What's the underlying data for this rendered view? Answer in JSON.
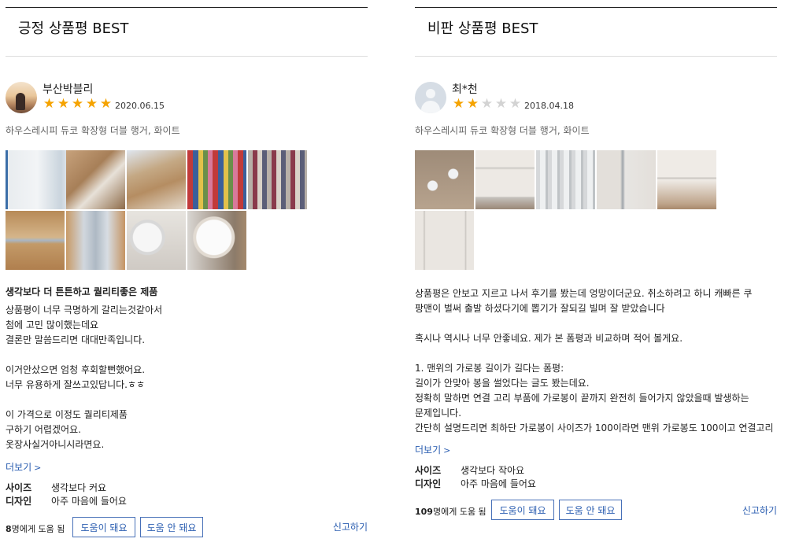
{
  "positive": {
    "section_title": "긍정 상품평 BEST",
    "nickname": "부산박블리",
    "rating": 5,
    "date": "2020.06.15",
    "product": "하우스레시피 듀코 확장형 더블 행거, 화이트",
    "headline": "생각보다 더 튼튼하고 퀄리티좋은 제품",
    "body_lines": [
      "상품평이 너무 극명하게 갈리는것같아서",
      "첨에 고민 많이했는데요",
      "결론만 말씀드리면 대대만족입니다.",
      "",
      "이거안샀으면 엄청 후회할뻔했어요.",
      "너무 유용하게 잘쓰고있답니다.ㅎㅎ",
      "",
      "이 가격으로 이정도 퀄리티제품",
      "구하기 어렵겠어요.",
      "옷장사실거아니시라면요."
    ],
    "more_label": "더보기",
    "attrs": [
      {
        "key": "사이즈",
        "value": "생각보다 커요"
      },
      {
        "key": "디자인",
        "value": "아주 마음에 들어요"
      }
    ],
    "helpful_count": "8",
    "helpful_suffix": "명에게 도움 됨",
    "helpful_yes": "도움이 돼요",
    "helpful_no": "도움 안 돼요",
    "report": "신고하기"
  },
  "negative": {
    "section_title": "비판 상품평 BEST",
    "nickname": "최*천",
    "rating": 2,
    "date": "2018.04.18",
    "product": "하우스레시피 듀코 확장형 더블 행거, 화이트",
    "body_lines": [
      "상품평은 안보고 지르고 나서 후기를 봤는데 엉망이더군요. 취소하려고 하니 캐빠른 쿠",
      "팡맨이 벌써 출발 하셨다기에 뽑기가 잘되길 빌며 잘 받았습니다",
      "",
      "혹시나 역시나 너무 안좋네요. 제가 본 폼평과 비교하며 적어 볼게요.",
      "",
      "1. 맨위의 가로봉 길이가 길다는 폼평:",
      "길이가 안맞아 봉을 썰었다는 글도 봤는데요.",
      "정확히 말하면 연결 고리 부품에 가로봉이 끝까지 완전히 들어가지 않았을때 발생하는",
      "문제입니다.",
      "간단히 설명드리면 최하단 가로봉이 사이즈가 100이라면 맨위 가로봉도 100이고 연결고리"
    ],
    "more_label": "더보기",
    "attrs": [
      {
        "key": "사이즈",
        "value": "생각보다 작아요"
      },
      {
        "key": "디자인",
        "value": "아주 마음에 들어요"
      }
    ],
    "helpful_count": "109",
    "helpful_suffix": "명에게 도움 됨",
    "helpful_yes": "도움이 돼요",
    "helpful_no": "도움 안 돼요",
    "report": "신고하기"
  },
  "icons": {
    "star": "star-icon",
    "chevron": "chevron-right-icon"
  }
}
